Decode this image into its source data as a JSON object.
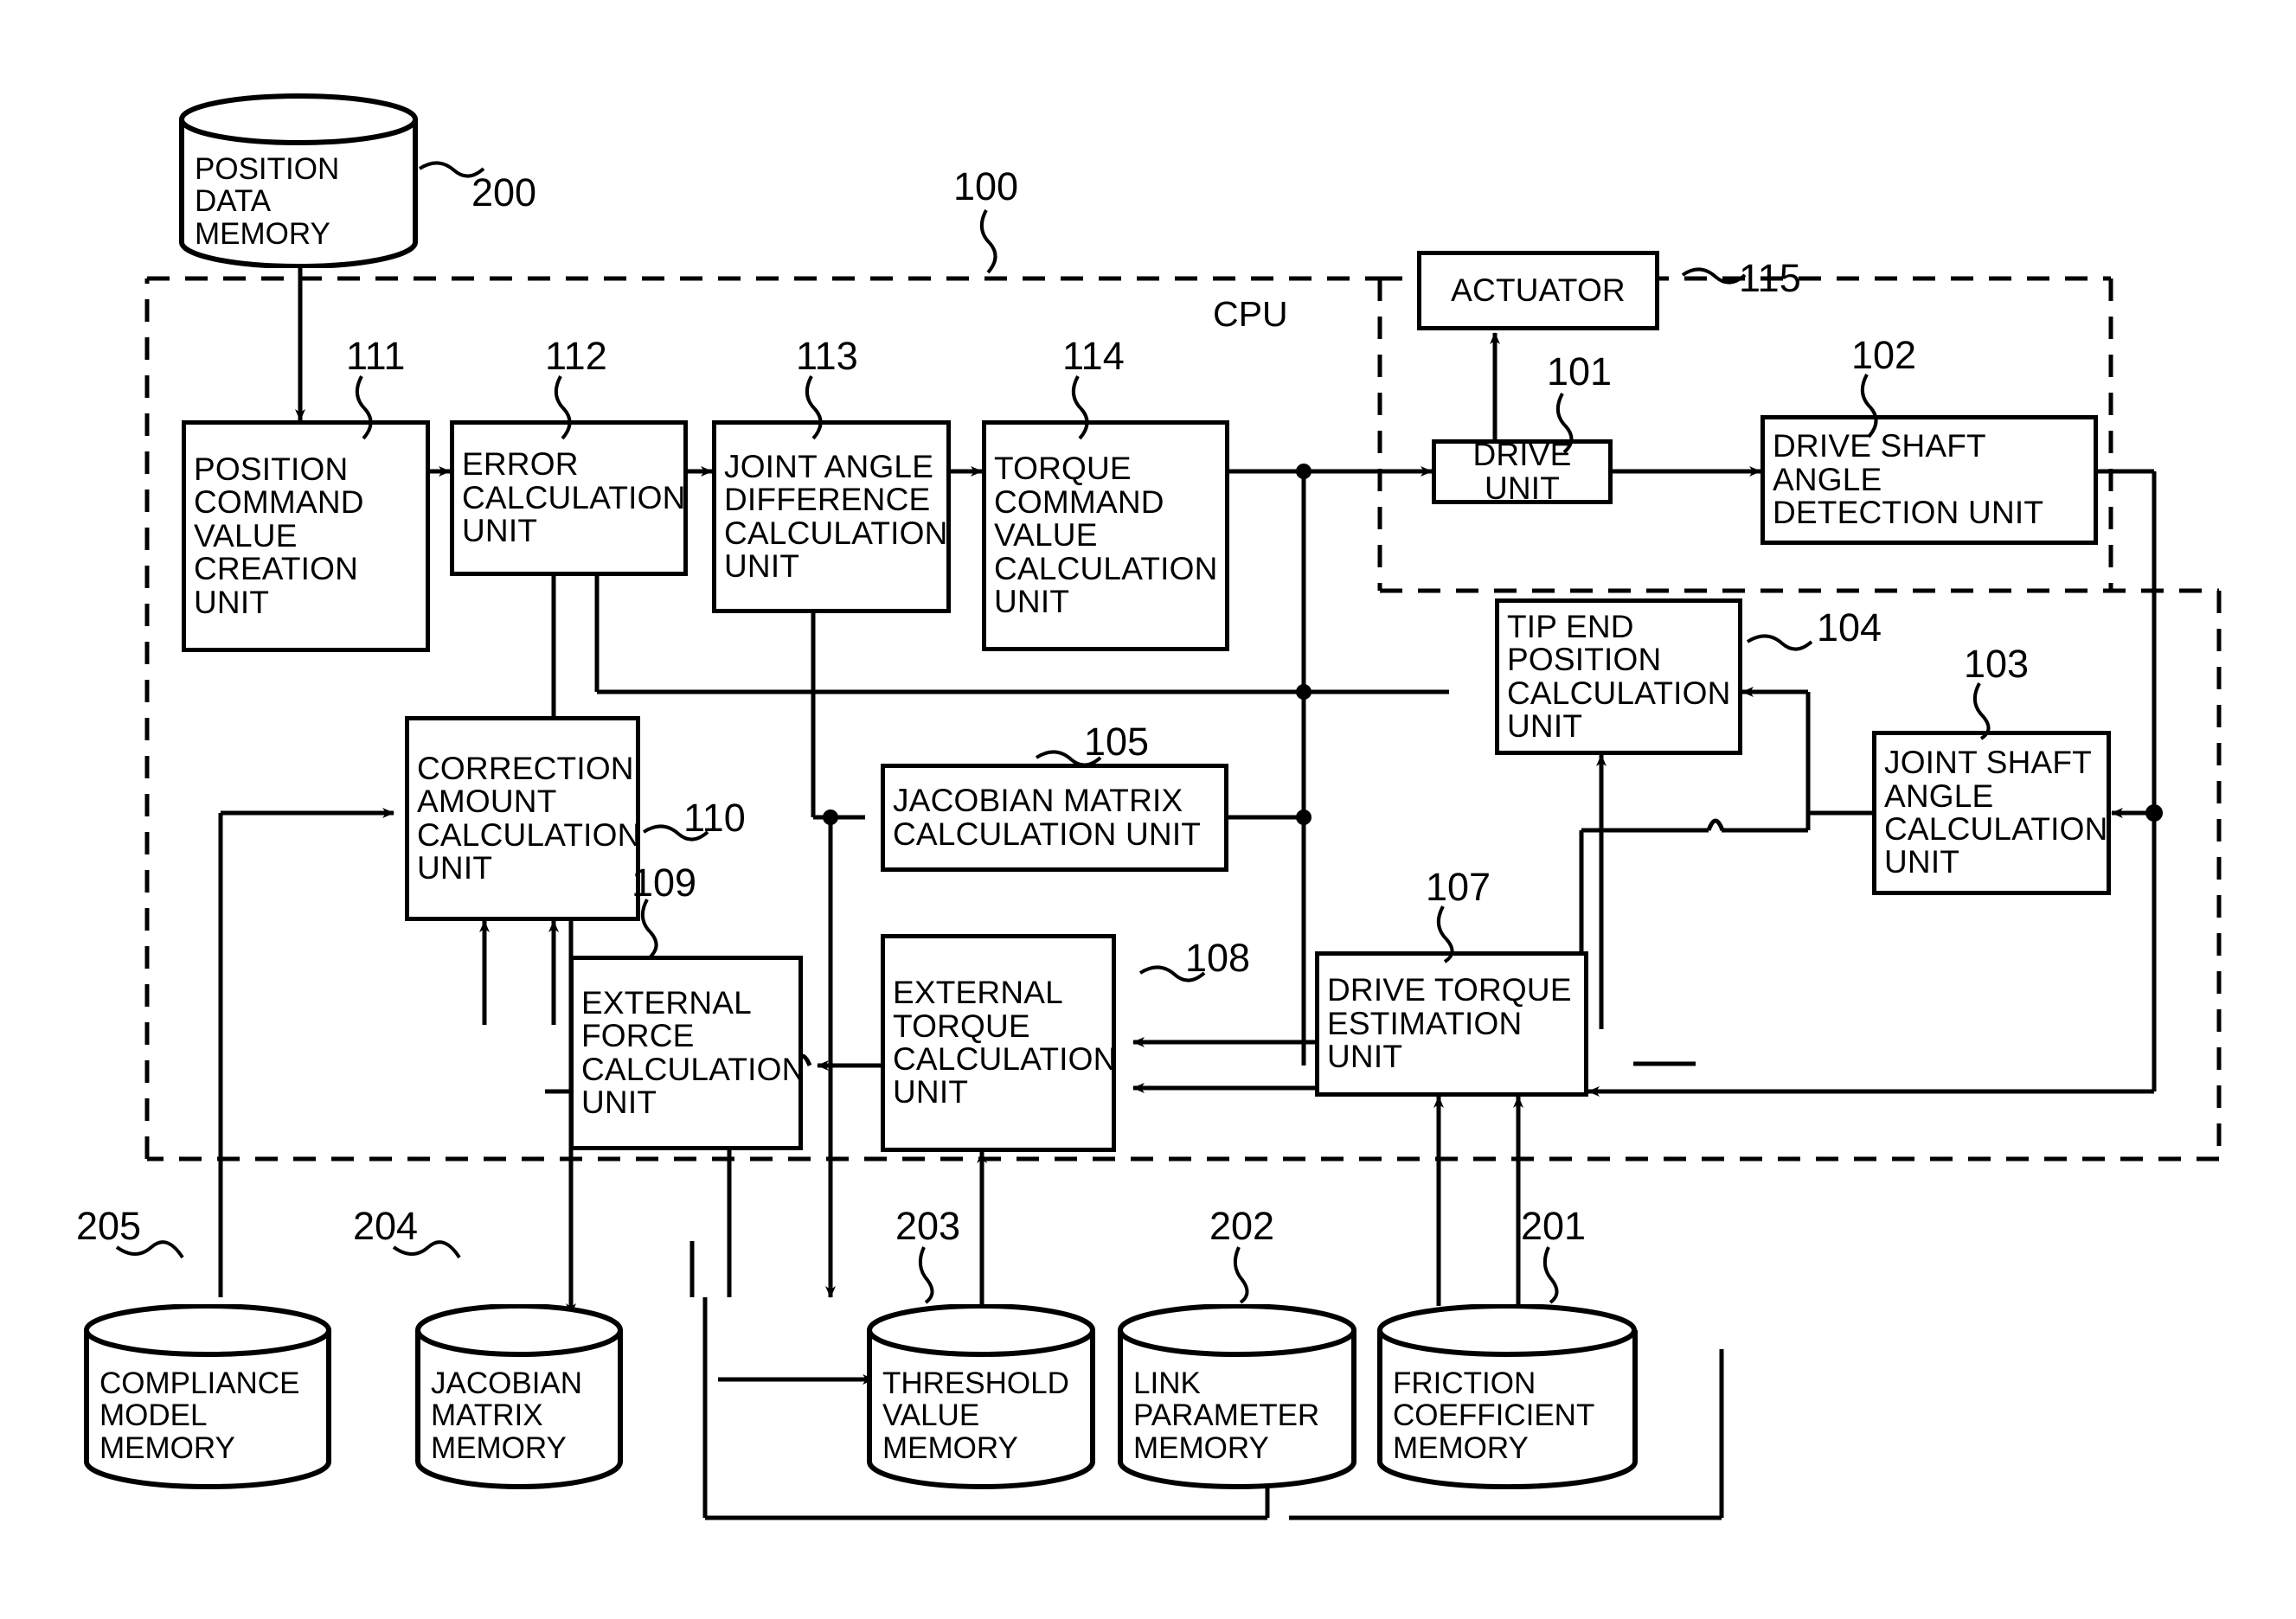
{
  "figure": {
    "type": "block-diagram",
    "cpu_label": "CPU",
    "cpu_ref": "100"
  },
  "blocks": [
    {
      "id": "b111",
      "ref": "111",
      "label": "POSITION\nCOMMAND\nVALUE\nCREATION\nUNIT"
    },
    {
      "id": "b112",
      "ref": "112",
      "label": "ERROR\nCALCULATION\nUNIT"
    },
    {
      "id": "b113",
      "ref": "113",
      "label": "JOINT ANGLE\nDIFFERENCE\nCALCULATION\nUNIT"
    },
    {
      "id": "b114",
      "ref": "114",
      "label": "TORQUE\nCOMMAND\nVALUE\nCALCULATION\nUNIT"
    },
    {
      "id": "b115",
      "ref": "115",
      "label": "ACTUATOR"
    },
    {
      "id": "b101",
      "ref": "101",
      "label": "DRIVE UNIT"
    },
    {
      "id": "b102",
      "ref": "102",
      "label": "DRIVE SHAFT\nANGLE\nDETECTION UNIT"
    },
    {
      "id": "b104",
      "ref": "104",
      "label": "TIP END\nPOSITION\nCALCULATION\nUNIT"
    },
    {
      "id": "b103",
      "ref": "103",
      "label": "JOINT SHAFT\nANGLE\nCALCULATION\nUNIT"
    },
    {
      "id": "b105",
      "ref": "105",
      "label": "JACOBIAN MATRIX\nCALCULATION UNIT"
    },
    {
      "id": "b110",
      "ref": "110",
      "label": "CORRECTION\nAMOUNT\nCALCULATION\nUNIT"
    },
    {
      "id": "b109",
      "ref": "109",
      "label": "EXTERNAL\nFORCE\nCALCULATION\nUNIT"
    },
    {
      "id": "b108",
      "ref": "108",
      "label": "EXTERNAL\nTORQUE\nCALCULATION\nUNIT"
    },
    {
      "id": "b107",
      "ref": "107",
      "label": "DRIVE TORQUE\nESTIMATION\nUNIT"
    }
  ],
  "memories": [
    {
      "id": "m200",
      "ref": "200",
      "label": "POSITION\nDATA\nMEMORY"
    },
    {
      "id": "m205",
      "ref": "205",
      "label": "COMPLIANCE\nMODEL\nMEMORY"
    },
    {
      "id": "m204",
      "ref": "204",
      "label": "JACOBIAN\nMATRIX\nMEMORY"
    },
    {
      "id": "m203",
      "ref": "203",
      "label": "THRESHOLD\nVALUE\nMEMORY"
    },
    {
      "id": "m202",
      "ref": "202",
      "label": "LINK\nPARAMETER\nMEMORY"
    },
    {
      "id": "m201",
      "ref": "201",
      "label": "FRICTION\nCOEFFICIENT\nMEMORY"
    }
  ],
  "colors": {
    "stroke": "#000000",
    "background": "#ffffff"
  }
}
